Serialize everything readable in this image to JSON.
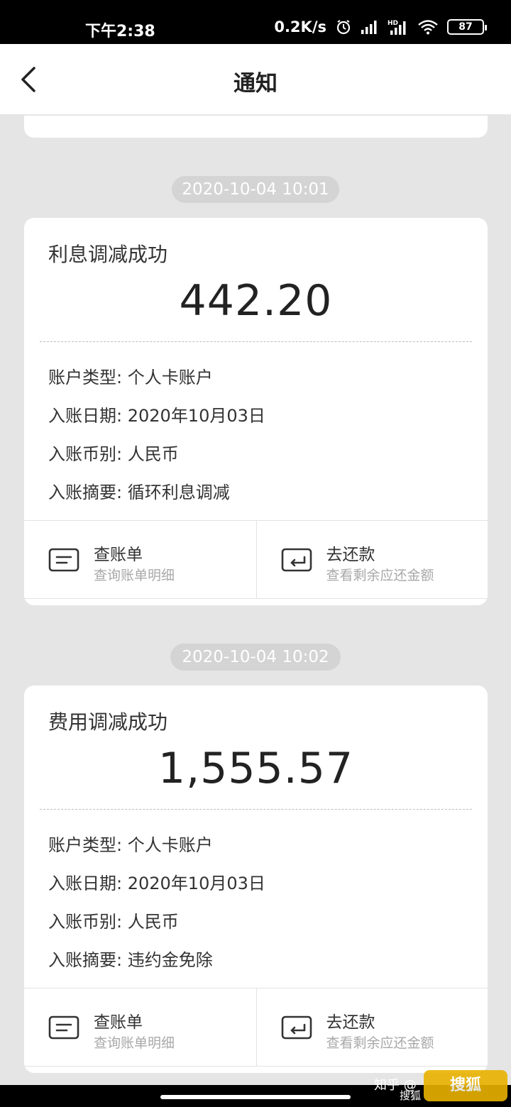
{
  "status_bar": {
    "time": "下午2:38",
    "net_speed": "0.2K/s",
    "battery": "87",
    "icons": [
      "alarm-icon",
      "signal-icon",
      "hd-signal-icon",
      "wifi-icon",
      "battery-icon"
    ]
  },
  "header": {
    "title": "通知",
    "back_icon": "chevron-left-icon"
  },
  "cards": [
    {
      "timestamp": "2020-10-04 10:01",
      "title": "利息调减成功",
      "amount": "442.20",
      "rows": [
        {
          "label": "账户类型:",
          "value": "个人卡账户"
        },
        {
          "label": "入账日期:",
          "value": "2020年10月03日"
        },
        {
          "label": "入账币别:",
          "value": "人民币"
        },
        {
          "label": "入账摘要:",
          "value": "循环利息调减"
        }
      ],
      "actions": [
        {
          "icon": "bill-icon",
          "label": "查账单",
          "sub": "查询账单明细"
        },
        {
          "icon": "repay-icon",
          "label": "去还款",
          "sub": "查看剩余应还金额"
        }
      ]
    },
    {
      "timestamp": "2020-10-04 10:02",
      "title": "费用调减成功",
      "amount": "1,555.57",
      "rows": [
        {
          "label": "账户类型:",
          "value": "个人卡账户"
        },
        {
          "label": "入账日期:",
          "value": "2020年10月03日"
        },
        {
          "label": "入账币别:",
          "value": "人民币"
        },
        {
          "label": "入账摘要:",
          "value": "违约金免除"
        }
      ],
      "actions": [
        {
          "icon": "bill-icon",
          "label": "查账单",
          "sub": "查询账单明细"
        },
        {
          "icon": "repay-icon",
          "label": "去还款",
          "sub": "查看剩余应还金额"
        }
      ]
    }
  ],
  "watermark": {
    "text1": "知乎 @",
    "text2": "搜狐",
    "logo_text": "搜狐"
  },
  "colors": {
    "background": "#e5e5e5",
    "card": "#ffffff",
    "timestamp_pill": "#d4d4d4",
    "secondary_text": "#a8a8a8"
  }
}
